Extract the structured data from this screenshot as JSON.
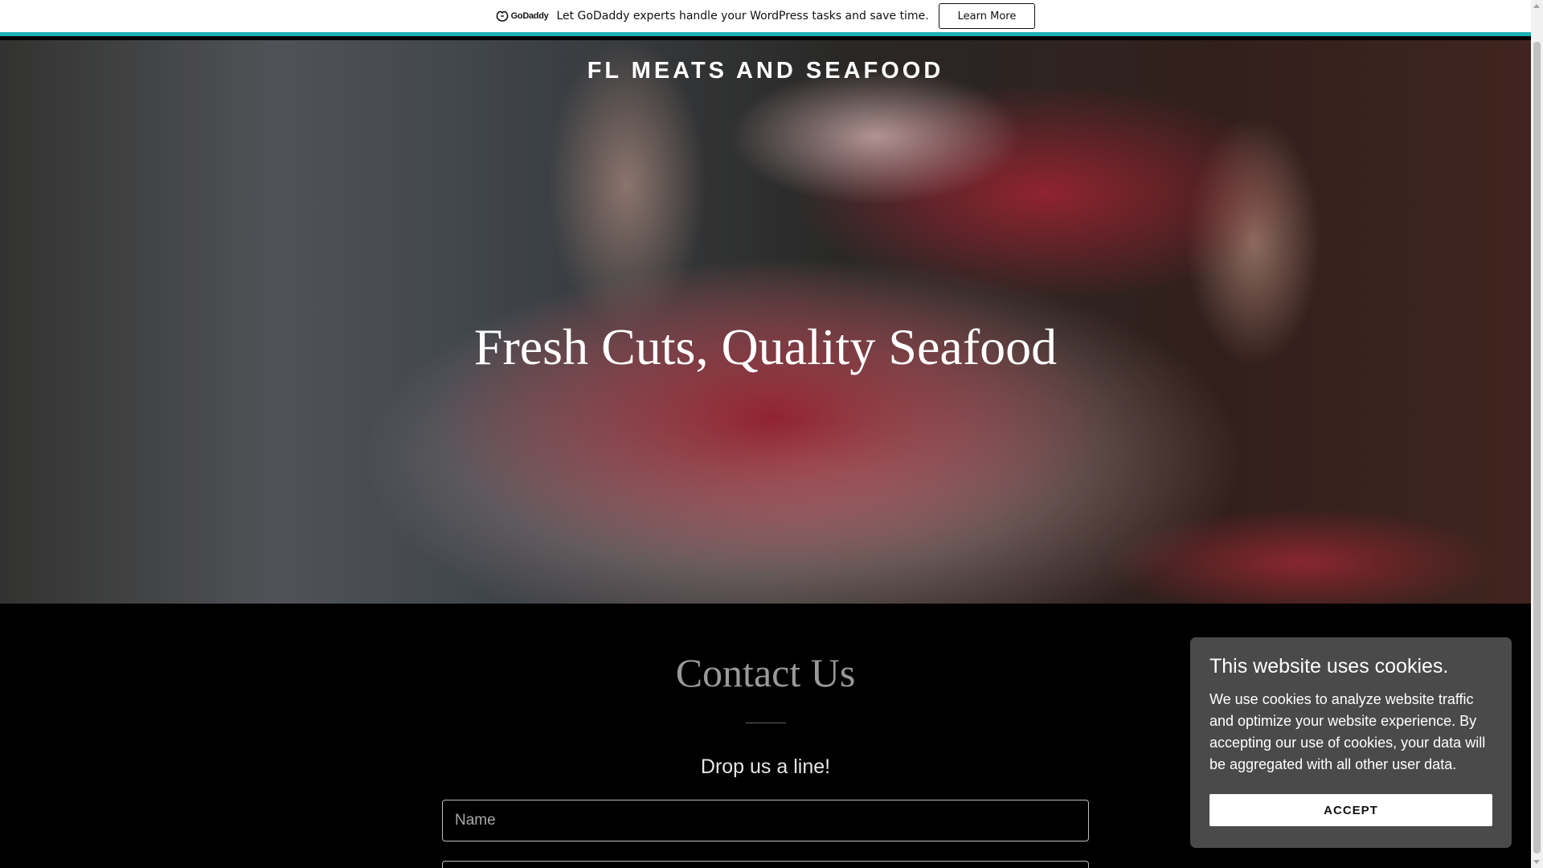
{
  "promo": {
    "logo_text": "GoDaddy",
    "message": "Let GoDaddy experts handle your WordPress tasks and save time.",
    "button_label": "Learn More",
    "accent_color": "#1bb0b4"
  },
  "hero": {
    "brand": "FL MEATS AND SEAFOOD",
    "title": "Fresh Cuts, Quality Seafood"
  },
  "contact": {
    "title": "Contact Us",
    "subtitle": "Drop us a line!",
    "name_placeholder": "Name",
    "email_placeholder": ""
  },
  "cookie": {
    "title": "This website uses cookies.",
    "body": "We use cookies to analyze website traffic and optimize your website experience. By accepting our use of cookies, your data will be aggregated with all other user data.",
    "accept_label": "ACCEPT"
  }
}
